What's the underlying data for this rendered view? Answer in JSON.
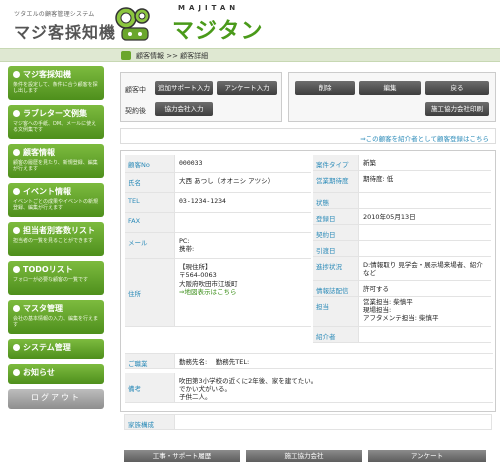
{
  "header": {
    "logo_sub": "ツタエルの顧客管理システム",
    "logo_main": "マジ客採知機",
    "brand_small": "MAJITAN",
    "brand_big": "マジタン"
  },
  "breadcrumb": "顧客情報 >> 顧客詳細",
  "sidebar": {
    "items": [
      {
        "title": "マジ客採知機",
        "desc": "条件を設定して、条件に合う顧客を探し出します"
      },
      {
        "title": "ラブレター文例集",
        "desc": "マジ客への手紙、DM、メールに使える文例集です"
      },
      {
        "title": "顧客情報",
        "desc": "顧客の履歴を見たり、新規登録、編集が行えます"
      },
      {
        "title": "イベント情報",
        "desc": "イベントごとの成果やイベントの新規登録、編集が行えます"
      },
      {
        "title": "担当者別客数リスト",
        "desc": "担当者の一覧を見ることができます"
      },
      {
        "title": "TODOリスト",
        "desc": "フォローが必要な顧客の一覧です"
      },
      {
        "title": "マスタ管理",
        "desc": "会社の基本情報の入力、編集を行えます"
      },
      {
        "title": "システム管理",
        "desc": ""
      },
      {
        "title": "お知らせ",
        "desc": ""
      }
    ],
    "logout": "ログアウト"
  },
  "actions": {
    "label_customer": "顧客中",
    "label_contract": "契約後",
    "btn_work_support": "追加サポート入力",
    "btn_questionnaire": "アンケート入力",
    "btn_partner": "協力会社入力",
    "btn_delete": "削除",
    "btn_edit": "編集",
    "btn_back": "戻る",
    "btn_print": "施工協力会社印刷"
  },
  "intro_link": "⇒この顧客を紹介者として顧客登録はこちら",
  "customer": {
    "left": [
      {
        "k": "顧客No",
        "v": "000033"
      },
      {
        "k": "氏名",
        "v": "大西 あつし（オオニシ アツシ）"
      },
      {
        "k": "TEL",
        "v": "03-1234-1234"
      },
      {
        "k": "FAX",
        "v": ""
      },
      {
        "k": "メール",
        "v": "PC:\n携帯:"
      }
    ],
    "address_label": "住所",
    "address_head": "【現住所】",
    "address_zip": "〒564-0063",
    "address_line": "大阪府吹田市江坂町",
    "address_map": "⇒地図表示はこちら",
    "right": [
      {
        "k": "案件タイプ",
        "v": "新築"
      },
      {
        "k": "営業期待度",
        "v": "期待度: 低"
      },
      {
        "k": "状態",
        "v": ""
      },
      {
        "k": "登録日",
        "v": "2010年05月13日"
      },
      {
        "k": "契約日",
        "v": ""
      },
      {
        "k": "引渡日",
        "v": ""
      },
      {
        "k": "進捗状況",
        "v": "D:情報取り 見学会・展示場来場者、紹介など"
      },
      {
        "k": "情報誌配信",
        "v": "許可する"
      },
      {
        "k": "担当",
        "v": "営業担当: 柴慎平\n現場担当:\nアフタメンテ担当: 柴慎平"
      },
      {
        "k": "紹介者",
        "v": ""
      }
    ],
    "job_label": "ご職業",
    "job_value": "勤務先名:　 勤務先TEL:",
    "memo_label": "備考",
    "memo_value": "吹田第3小学校の近くに2年後、家を建てたい。\nでかい犬がいる。\n子供二人。",
    "family_label": "家族構成",
    "family_value": ""
  },
  "tabs": [
    "工事・サポート履歴",
    "施工協力会社",
    "アンケート"
  ]
}
